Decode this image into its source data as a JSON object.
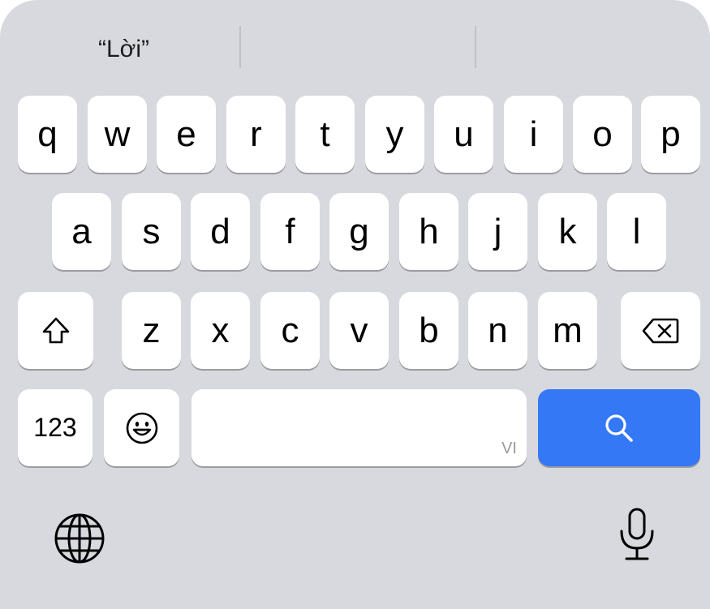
{
  "suggestions": [
    "“Lời”",
    "",
    ""
  ],
  "keys": {
    "row1": [
      "q",
      "w",
      "e",
      "r",
      "t",
      "y",
      "u",
      "i",
      "o",
      "p"
    ],
    "row2": [
      "a",
      "s",
      "d",
      "f",
      "g",
      "h",
      "j",
      "k",
      "l"
    ],
    "row3": [
      "z",
      "x",
      "c",
      "v",
      "b",
      "n",
      "m"
    ]
  },
  "num_label": "123",
  "space_language": "VI",
  "icons": {
    "shift": "shift-icon",
    "delete": "delete-backspace-icon",
    "emoji": "emoji-smile-icon",
    "search": "search-icon",
    "globe": "globe-icon",
    "mic": "microphone-icon"
  },
  "colors": {
    "keyboard_bg": "#d7d9de",
    "key_bg": "#ffffff",
    "action_key": "#3478f6"
  }
}
